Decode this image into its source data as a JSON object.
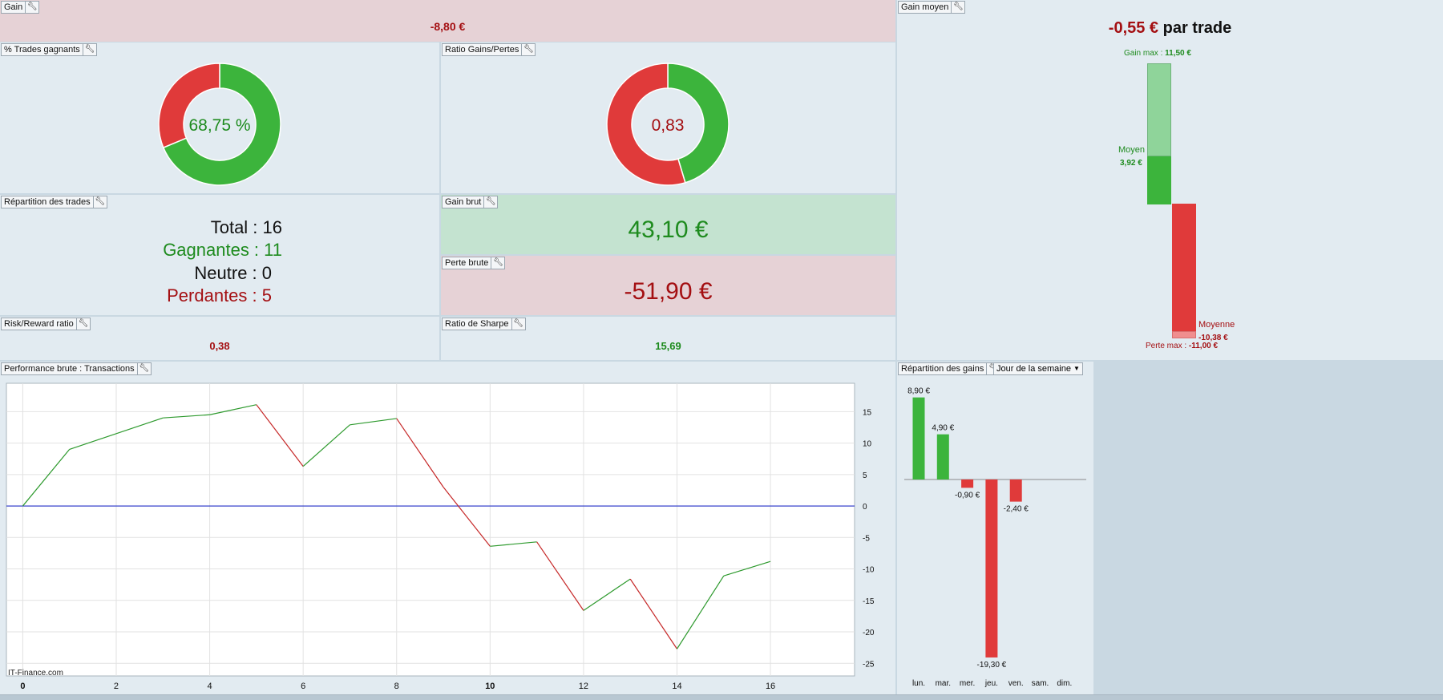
{
  "gain": {
    "label": "Gain",
    "value": "-8,80 €"
  },
  "trades_gagnants": {
    "label": "% Trades gagnants",
    "value": "68,75 %",
    "fraction": 0.6875
  },
  "ratio_gp": {
    "label": "Ratio Gains/Pertes",
    "value": "0,83",
    "fraction": 0.4537
  },
  "repartition_trades": {
    "label": "Répartition des trades",
    "total": "Total : 16",
    "gagnantes": "Gagnantes : 11",
    "neutre": "Neutre : 0",
    "perdantes": "Perdantes : 5"
  },
  "gain_brut": {
    "label": "Gain brut",
    "value": "43,10 €"
  },
  "perte_brute": {
    "label": "Perte brute",
    "value": "-51,90 €"
  },
  "risk_reward": {
    "label": "Risk/Reward ratio",
    "value": "0,38"
  },
  "sharpe": {
    "label": "Ratio de Sharpe",
    "value": "15,69"
  },
  "gain_moyen": {
    "label": "Gain moyen",
    "value": "-0,55 €",
    "suffix": " par trade",
    "gain_max_label": "Gain max : ",
    "gain_max_value": "11,50 €",
    "moyen_label": "Moyen",
    "moyen_value": "3,92 €",
    "moyenne_label": "Moyenne",
    "moyenne_value": "-10,38 €",
    "perte_max_label": "Perte max : ",
    "perte_max_value": "-11,00 €",
    "gain_max": 11.5,
    "gain_moyen": 3.92,
    "perte_moyenne": -10.38,
    "perte_max": -11.0
  },
  "performance": {
    "label": "Performance brute : Transactions",
    "watermark": "IT-Finance.com"
  },
  "repartition_gains": {
    "label": "Répartition des gains",
    "dropdown": "Jour de la semaine"
  },
  "chart_data": [
    {
      "type": "line",
      "x": [
        0,
        1,
        2,
        3,
        4,
        5,
        6,
        7,
        8,
        9,
        10,
        11,
        12,
        13,
        14,
        15,
        16
      ],
      "series": [
        {
          "values": [
            0,
            9,
            11.5,
            14,
            14.5,
            16.1,
            6.3,
            12.9,
            13.9,
            3,
            -6.4,
            -5.7,
            -16.6,
            -11.6,
            -22.7,
            -11.1,
            -8.8
          ]
        }
      ],
      "x_ticks": [
        "0",
        "2",
        "4",
        "6",
        "8",
        "10",
        "12",
        "14",
        "16"
      ],
      "y_ticks": [
        "15",
        "10",
        "5",
        "0",
        "-5",
        "-10",
        "-15",
        "-20",
        "-25"
      ],
      "xlim": [
        -0.35,
        17.8
      ],
      "ylim": [
        -27,
        19.5
      ],
      "colors": {
        "up": "#2e9a2e",
        "down": "#c62828",
        "zero": "#2433c8"
      }
    },
    {
      "type": "bar",
      "categories": [
        "lun.",
        "mar.",
        "mer.",
        "jeu.",
        "ven.",
        "sam.",
        "dim."
      ],
      "values": [
        8.9,
        4.9,
        -0.9,
        -19.3,
        -2.4,
        null,
        null
      ],
      "labels": [
        "8,90 €",
        "4,90 €",
        "-0,90 €",
        "-19,30 €",
        "-2,40 €",
        "",
        ""
      ],
      "colors": {
        "pos": "#3cb43c",
        "neg": "#e03a3a"
      }
    }
  ]
}
